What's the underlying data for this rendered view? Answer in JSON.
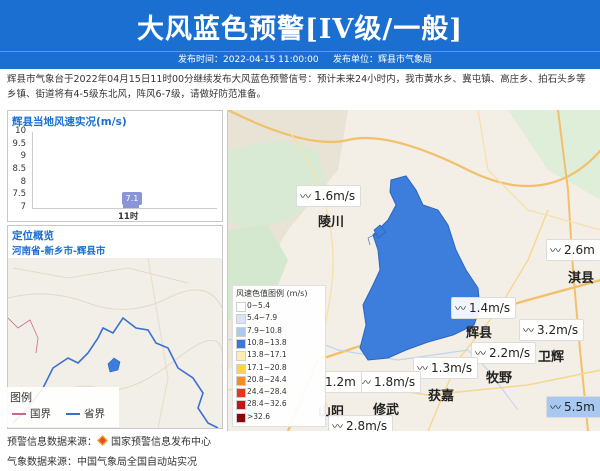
{
  "header": {
    "title": "大风蓝色预警[IV级/一般]",
    "time_label": "发布时间：2022-04-15 11:00:00",
    "unit_label": "发布单位：辉县市气象局"
  },
  "description": "辉县市气象台于2022年04月15日11时00分继续发布大风蓝色预警信号：预计未来24小时内，我市黄水乡、冀屯镇、高庄乡、拍石头乡等乡镇、街道将有4-5级东北风，阵风6-7级，请做好防范准备。",
  "wind_panel": {
    "title": "辉县当地风速实况(m/s)",
    "y_ticks": [
      "10",
      "9.5",
      "9",
      "8.5",
      "8",
      "7.5",
      "7"
    ]
  },
  "chart_data": {
    "type": "bar",
    "categories": [
      "11时"
    ],
    "values": [
      7.1
    ],
    "ylabel": "",
    "ylim": [
      7,
      10
    ],
    "value_labels": [
      "7.1"
    ]
  },
  "location_panel": {
    "title": "定位概览",
    "path": "河南省-新乡市-辉县市"
  },
  "minimap_legend": {
    "title": "图例",
    "items": [
      {
        "label": "国界",
        "color": "#c86a8a"
      },
      {
        "label": "省界",
        "color": "#3c6fd0"
      }
    ]
  },
  "map": {
    "places": [
      {
        "name": "陵川"
      },
      {
        "name": "辉县"
      },
      {
        "name": "淇县"
      },
      {
        "name": "卫辉"
      },
      {
        "name": "牧野"
      },
      {
        "name": "获嘉"
      },
      {
        "name": "修武"
      },
      {
        "name": "山阳"
      }
    ],
    "wind_tags": [
      {
        "value": "1.6m/s"
      },
      {
        "value": "2.6m"
      },
      {
        "value": "1.4m/s"
      },
      {
        "value": "3.2m/s"
      },
      {
        "value": "2.2m/s"
      },
      {
        "value": "1.3m/s"
      },
      {
        "value": "1.8m/s"
      },
      {
        "value": "1.2m"
      },
      {
        "value": "2.8m/s"
      },
      {
        "value": "5.5m"
      }
    ],
    "wind_icon": "wind-icon",
    "legend": {
      "title": "风速色值图例 (m/s)",
      "items": [
        {
          "label": "0~5.4",
          "color": "#ffffff"
        },
        {
          "label": "5.4~7.9",
          "color": "#d7e6f5"
        },
        {
          "label": "7.9~10.8",
          "color": "#a9c9ee"
        },
        {
          "label": "10.8~13.8",
          "color": "#3c78d8"
        },
        {
          "label": "13.8~17.1",
          "color": "#ffeeb0"
        },
        {
          "label": "17.1~20.8",
          "color": "#ffd24a"
        },
        {
          "label": "20.8~24.4",
          "color": "#f48c28"
        },
        {
          "label": "24.4~28.4",
          "color": "#e8351f"
        },
        {
          "label": "28.4~32.6",
          "color": "#c01818"
        },
        {
          "label": ">32.6",
          "color": "#8a0a0a"
        }
      ]
    }
  },
  "footer": {
    "warn_source": "预警信息数据来源：",
    "warn_source_org": "国家预警信息发布中心",
    "met_source": "气象数据来源：中国气象局全国自动站实况"
  },
  "colors": {
    "brand_blue": "#1a6fd0",
    "warning_area": "#3d7ddc"
  }
}
